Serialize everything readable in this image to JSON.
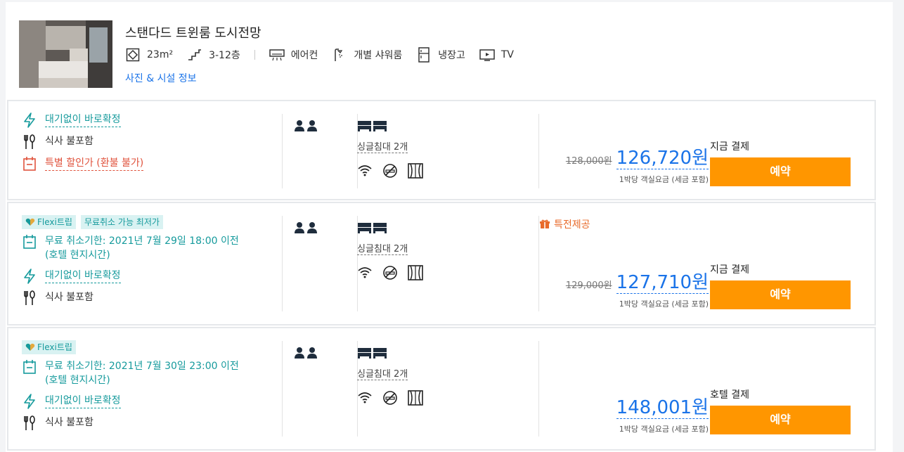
{
  "room": {
    "title": "스탠다드 트윈룸 도시전망",
    "amenities": [
      {
        "icon": "room-size-icon",
        "label": "23m²"
      },
      {
        "icon": "floor-stairs-icon",
        "label": "3-12층"
      },
      {
        "icon": "air-conditioner-icon",
        "label": "에어컨"
      },
      {
        "icon": "shower-icon",
        "label": "개별 샤워룸"
      },
      {
        "icon": "fridge-icon",
        "label": "냉장고"
      },
      {
        "icon": "tv-icon",
        "label": "TV"
      }
    ],
    "photos_link": "사진 & 시설 정보"
  },
  "rates": [
    {
      "features": {
        "instant": "대기없이 바로확정",
        "meal": "식사 불포함",
        "special_discount": "특별 할인가 (환불 불가)"
      },
      "bed": "싱글침대 2개",
      "old_price": "128,000원",
      "price": "126,720원",
      "price_note": "1박당 객실요금 (세금 포함)",
      "payment": "지금 결제",
      "book": "예약"
    },
    {
      "badges": [
        "Flexi트립",
        "무료취소 가능 최저가"
      ],
      "features": {
        "cancel_line1": "무료 취소기한: 2021년 7월 29일 18:00 이전",
        "cancel_line2": "(호텔 현지시간)",
        "instant": "대기없이 바로확정",
        "meal": "식사 불포함"
      },
      "bed": "싱글침대 2개",
      "special": "특전제공",
      "old_price": "129,000원",
      "price": "127,710원",
      "price_note": "1박당 객실요금 (세금 포함)",
      "payment": "지금 결제",
      "book": "예약"
    },
    {
      "badges": [
        "Flexi트립"
      ],
      "features": {
        "cancel_line1": "무료 취소기한: 2021년 7월 30일 23:00 이전",
        "cancel_line2": "(호텔 현지시간)",
        "instant": "대기없이 바로확정",
        "meal": "식사 불포함"
      },
      "bed": "싱글침대 2개",
      "price": "148,001원",
      "price_note": "1박당 객실요금 (세금 포함)",
      "payment": "호텔 결제",
      "book": "예약"
    }
  ],
  "colors": {
    "accent_blue": "#1a73e8",
    "teal": "#159a9c",
    "orange": "#ff9600",
    "red": "#e0533d"
  }
}
